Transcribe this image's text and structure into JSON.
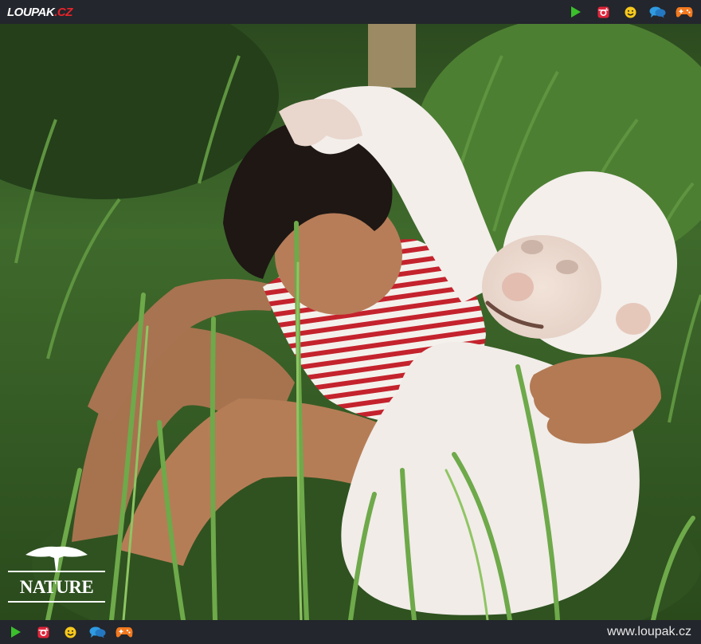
{
  "header": {
    "logo_main": "LOUPAK",
    "logo_tld": ".CZ",
    "icons": [
      "play-icon",
      "instagram-icon",
      "smiley-icon",
      "chat-icon",
      "gamepad-icon"
    ]
  },
  "photo": {
    "watermark_text": "NATURE"
  },
  "footer": {
    "icons": [
      "play-icon",
      "instagram-icon",
      "smiley-icon",
      "chat-icon",
      "gamepad-icon"
    ],
    "site_url": "www.loupak.cz"
  },
  "colors": {
    "bar_bg": "#23262c",
    "brand_red": "#e8232a",
    "play_green": "#3cbf2c",
    "instagram_red": "#e0263b",
    "smiley_yellow": "#f6c81b",
    "chat_blue": "#2f9be2",
    "gamepad_orange": "#f2791f"
  }
}
